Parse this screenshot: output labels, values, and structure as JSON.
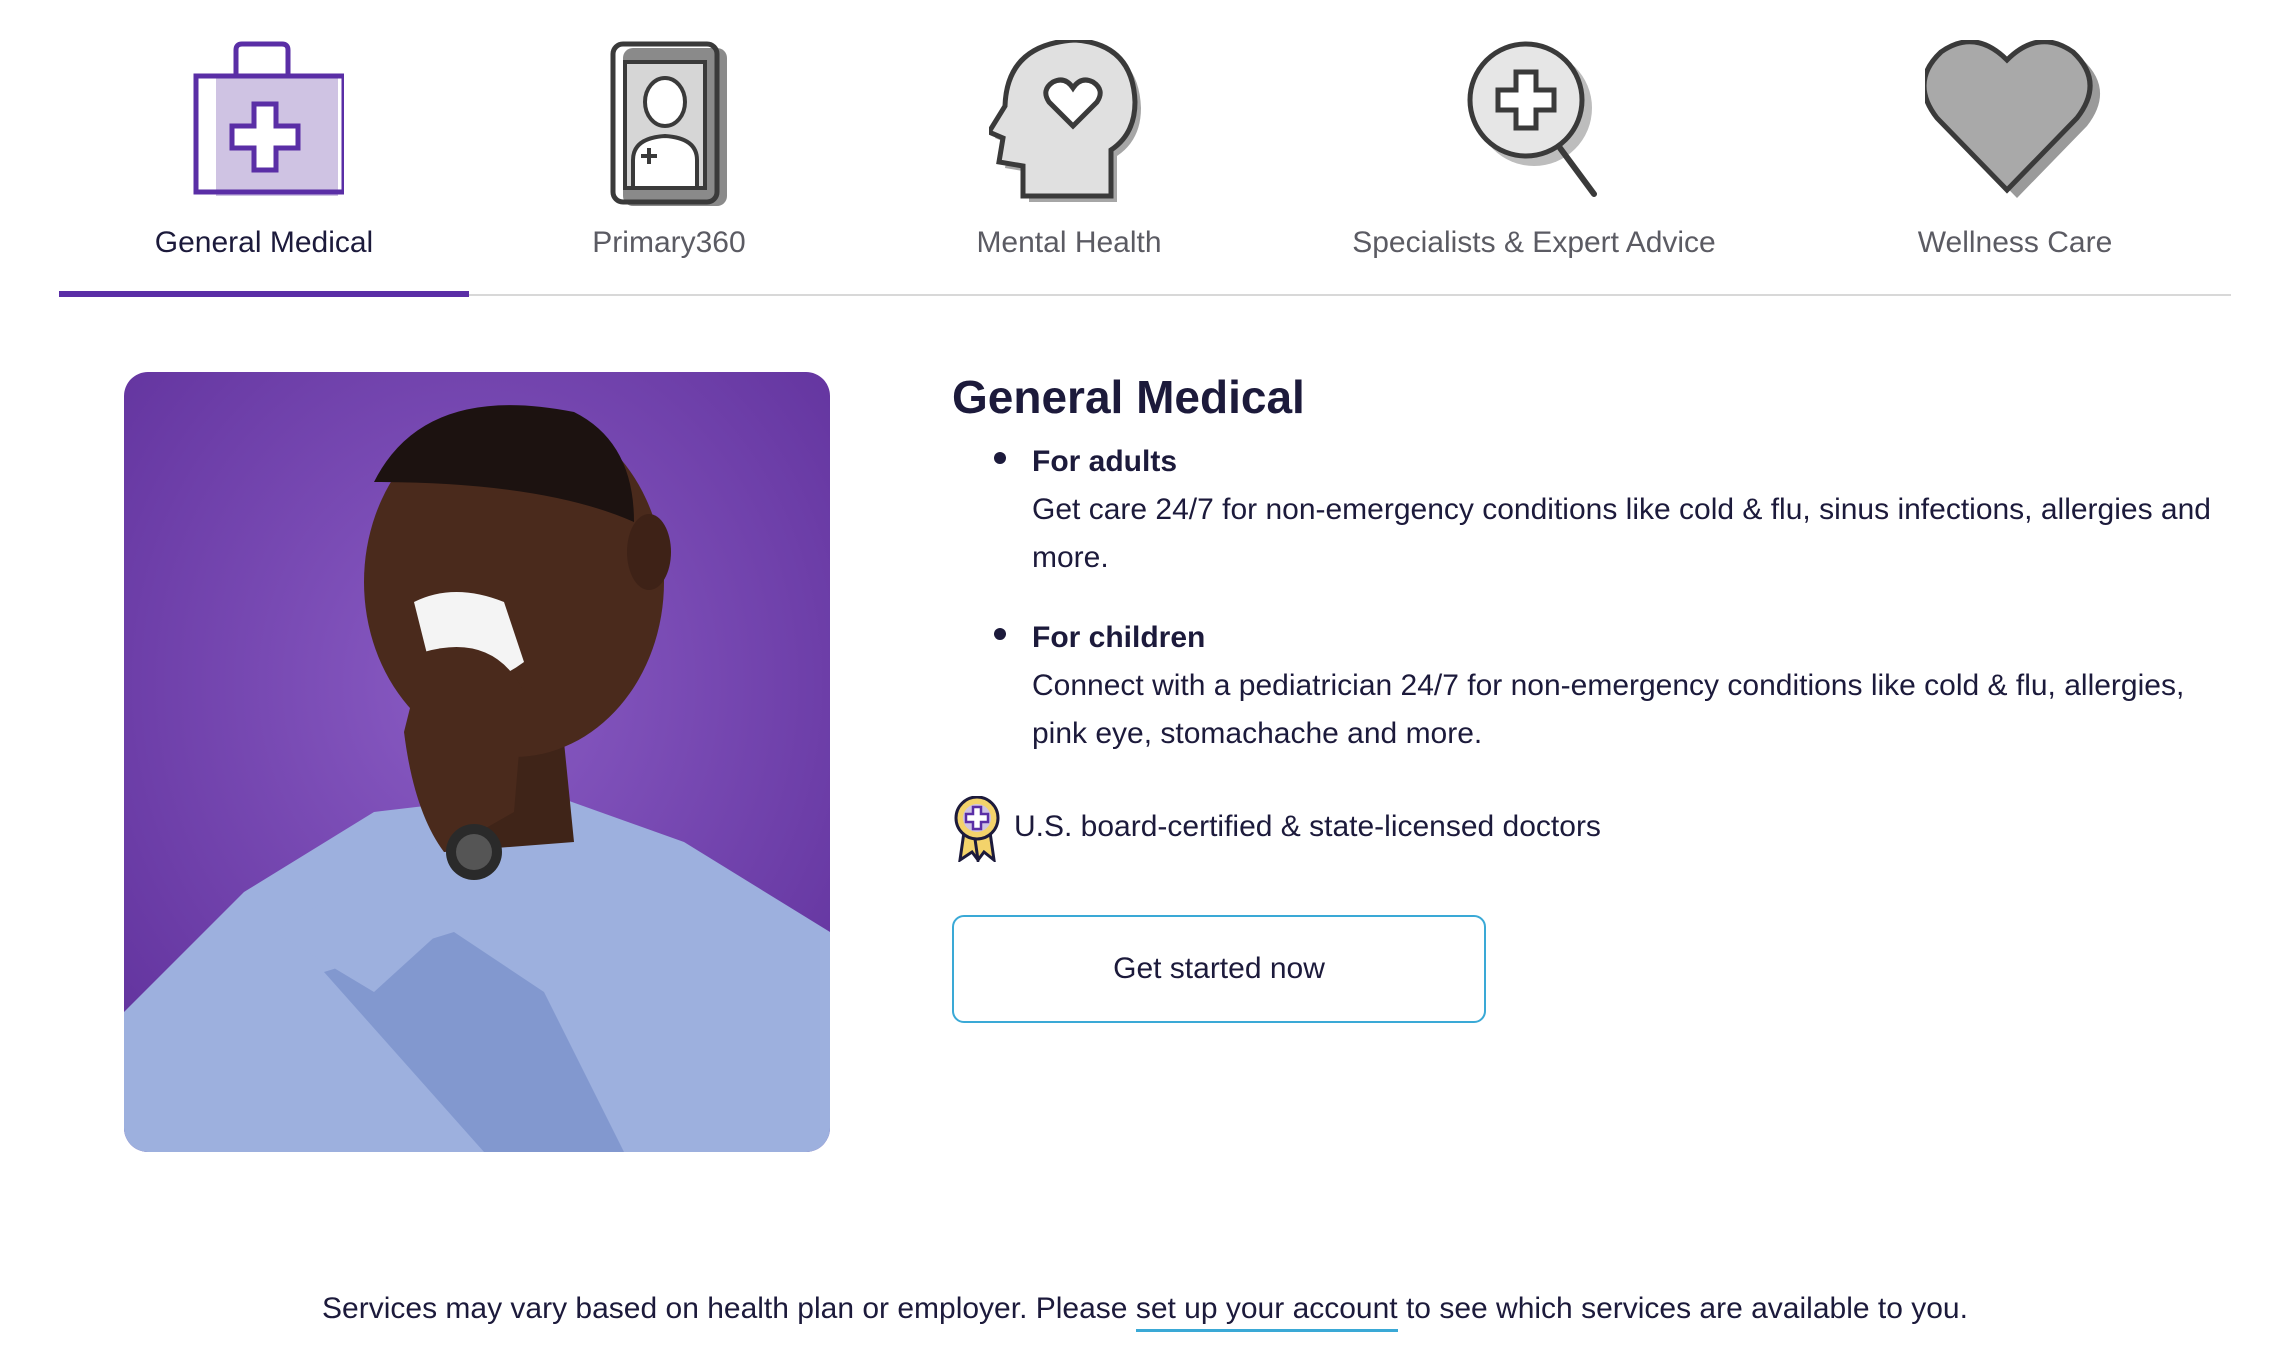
{
  "tabs": [
    {
      "label": "General Medical",
      "icon": "medical-kit-icon",
      "active": true
    },
    {
      "label": "Primary360",
      "icon": "doctor-badge-icon",
      "active": false
    },
    {
      "label": "Mental Health",
      "icon": "head-heart-icon",
      "active": false
    },
    {
      "label": "Specialists & Expert Advice",
      "icon": "magnifier-plus-icon",
      "active": false
    },
    {
      "label": "Wellness Care",
      "icon": "heart-icon",
      "active": false
    }
  ],
  "content": {
    "title": "General Medical",
    "bullets": [
      {
        "title": "For adults",
        "body": "Get care 24/7 for non-emergency conditions like cold & flu, sinus infections, allergies and more."
      },
      {
        "title": "For children",
        "body": "Connect with a pediatrician 24/7 for non-emergency conditions like cold & flu, allergies, pink eye, stomachache and more."
      }
    ],
    "certification": "U.S. board-certified & state-licensed doctors",
    "cta_label": "Get started now"
  },
  "footer": {
    "before": "Services may vary based on health plan or employer. Please ",
    "link": "set up your account",
    "after": " to see which services are available to you."
  },
  "colors": {
    "accent": "#5a2ea6",
    "link_underline": "#3aa9d6",
    "text": "#1c1a3b"
  }
}
